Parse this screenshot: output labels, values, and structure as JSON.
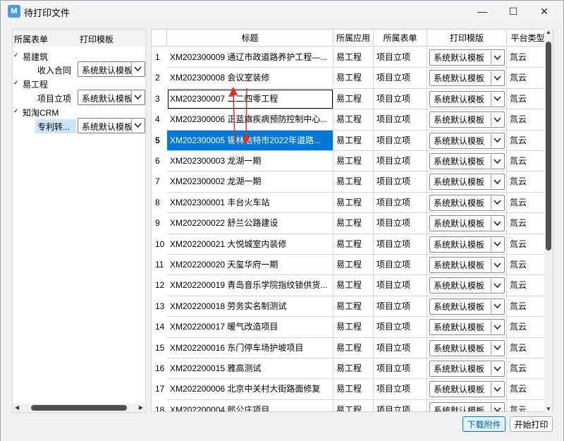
{
  "window": {
    "title": "待打印文件",
    "icon_text": "M",
    "controls": {
      "minimize": "—",
      "maximize": "☐",
      "close": "✕"
    }
  },
  "left_panel": {
    "headers": {
      "col1": "所属表单",
      "col2": "打印模板"
    },
    "tree": [
      {
        "label": "易建筑",
        "level": 0,
        "expanded": true
      },
      {
        "label": "收入合同",
        "level": 1,
        "template": "系统默认模板"
      },
      {
        "label": "易工程",
        "level": 0,
        "expanded": true
      },
      {
        "label": "项目立项",
        "level": 1,
        "template": "系统默认模板"
      },
      {
        "label": "知淘CRM",
        "level": 0,
        "expanded": true
      },
      {
        "label": "专利转...",
        "level": 1,
        "template": "系统默认模板",
        "selected": true
      }
    ]
  },
  "grid": {
    "columns": {
      "title": "标题",
      "app": "所属应用",
      "form": "所属表单",
      "template": "打印模版",
      "platform": "平台类型"
    },
    "rows": [
      {
        "num": "1",
        "title": "XM202300009 通辽市政道路养护工程—...",
        "app": "易工程",
        "form": "项目立项",
        "template": "系统默认模板",
        "platform": "氚云"
      },
      {
        "num": "2",
        "title": "XM202300008 会议室装修",
        "app": "易工程",
        "form": "项目立项",
        "template": "系统默认模板",
        "platform": "氚云"
      },
      {
        "num": "3",
        "title": "XM202300007 二二四零工程",
        "app": "易工程",
        "form": "项目立项",
        "template": "系统默认模板",
        "platform": "氚云"
      },
      {
        "num": "4",
        "title": "XM202300006 正蓝旗疾病预防控制中心...",
        "app": "易工程",
        "form": "项目立项",
        "template": "系统默认模板",
        "platform": "氚云"
      },
      {
        "num": "5",
        "title": "XM202300005 锡林浩特市2022年道路...",
        "app": "易工程",
        "form": "项目立项",
        "template": "系统默认模板",
        "platform": "氚云"
      },
      {
        "num": "6",
        "title": "XM202300003 龙湖一期",
        "app": "易工程",
        "form": "项目立项",
        "template": "系统默认模板",
        "platform": "氚云"
      },
      {
        "num": "7",
        "title": "XM202300002 龙湖一期",
        "app": "易工程",
        "form": "项目立项",
        "template": "系统默认模板",
        "platform": "氚云"
      },
      {
        "num": "8",
        "title": "XM202300001 丰台火车站",
        "app": "易工程",
        "form": "项目立项",
        "template": "系统默认模板",
        "platform": "氚云"
      },
      {
        "num": "9",
        "title": "XM202200022 舒兰公路建设",
        "app": "易工程",
        "form": "项目立项",
        "template": "系统默认模板",
        "platform": "氚云"
      },
      {
        "num": "10",
        "title": "XM202200021 大悦城室内装修",
        "app": "易工程",
        "form": "项目立项",
        "template": "系统默认模板",
        "platform": "氚云"
      },
      {
        "num": "11",
        "title": "XM202200020 天玺华府一期",
        "app": "易工程",
        "form": "项目立项",
        "template": "系统默认模板",
        "platform": "氚云"
      },
      {
        "num": "12",
        "title": "XM202200019 青岛音乐学院指纹锁供货...",
        "app": "易工程",
        "form": "项目立项",
        "template": "系统默认模板",
        "platform": "氚云"
      },
      {
        "num": "13",
        "title": "XM202200018 劳务实名制测试",
        "app": "易工程",
        "form": "项目立项",
        "template": "系统默认模板",
        "platform": "氚云"
      },
      {
        "num": "14",
        "title": "XM202200017     暖气改造项目",
        "app": "易工程",
        "form": "项目立项",
        "template": "系统默认模板",
        "platform": "氚云"
      },
      {
        "num": "15",
        "title": "XM202200016     东门停车场护坡项目",
        "app": "易工程",
        "form": "项目立项",
        "template": "系统默认模板",
        "platform": "氚云"
      },
      {
        "num": "16",
        "title": "XM202200015     雅高测试",
        "app": "易工程",
        "form": "项目立项",
        "template": "系统默认模板",
        "platform": "氚云"
      },
      {
        "num": "17",
        "title": "XM202200006     北京中关村大街路面修复",
        "app": "易工程",
        "form": "项目立项",
        "template": "系统默认模板",
        "platform": "氚云"
      },
      {
        "num": "18",
        "title": "XM202200004     郎公庄项目",
        "app": "易工程",
        "form": "项目立项",
        "template": "系统默认模板",
        "platform": "氚云"
      }
    ],
    "selected_row": "5"
  },
  "buttons": {
    "download": "下载附件",
    "print": "开始打印"
  },
  "colors": {
    "accent": "#0078d7",
    "selection": "#cce4f7",
    "annotation": "#e0301e"
  }
}
